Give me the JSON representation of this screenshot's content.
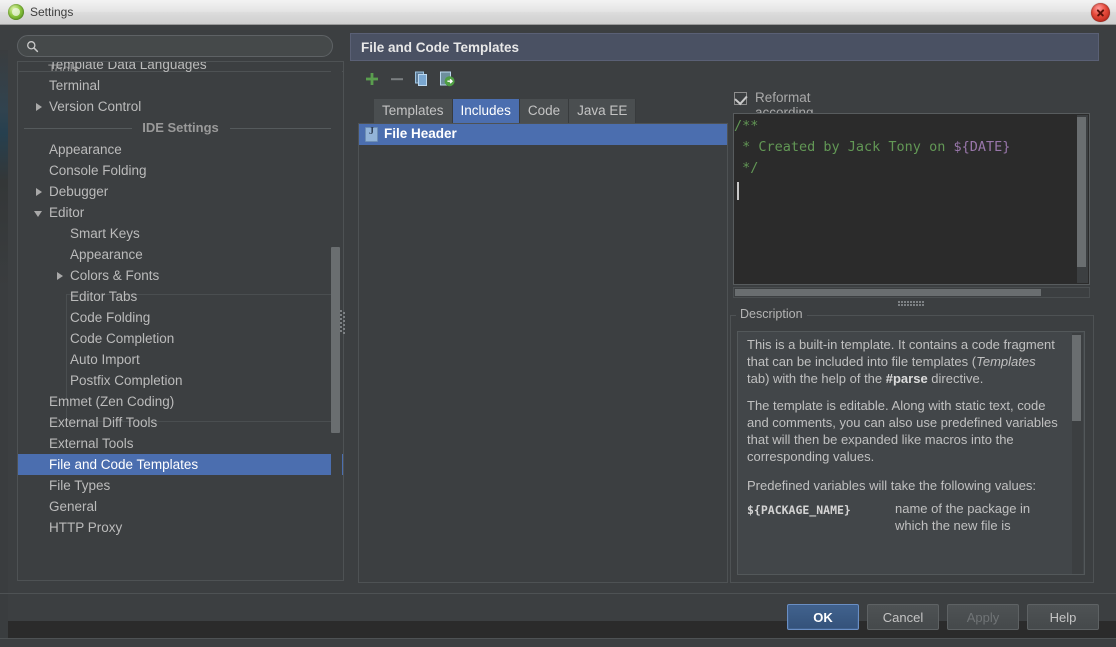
{
  "window": {
    "title": "Settings",
    "app_icon": "ide-logo-icon",
    "close_icon": "close-icon"
  },
  "sidebar": {
    "search": {
      "value": "",
      "placeholder": "",
      "icon": "search-icon"
    },
    "clipped_top_item": "Tools",
    "section_label": "IDE Settings",
    "items": [
      {
        "label": "Template Data Languages",
        "depth": 0,
        "arrow": "none",
        "selected": false
      },
      {
        "label": "Terminal",
        "depth": 0,
        "arrow": "none",
        "selected": false
      },
      {
        "label": "Version Control",
        "depth": 0,
        "arrow": "collapsed",
        "selected": false
      },
      {
        "label": "Appearance",
        "depth": 0,
        "arrow": "none",
        "selected": false
      },
      {
        "label": "Console Folding",
        "depth": 0,
        "arrow": "none",
        "selected": false
      },
      {
        "label": "Debugger",
        "depth": 0,
        "arrow": "collapsed",
        "selected": false
      },
      {
        "label": "Editor",
        "depth": 0,
        "arrow": "expanded",
        "selected": false
      },
      {
        "label": "Smart Keys",
        "depth": 1,
        "arrow": "none",
        "selected": false
      },
      {
        "label": "Appearance",
        "depth": 1,
        "arrow": "none",
        "selected": false
      },
      {
        "label": "Colors & Fonts",
        "depth": 1,
        "arrow": "collapsed",
        "selected": false
      },
      {
        "label": "Editor Tabs",
        "depth": 1,
        "arrow": "none",
        "selected": false
      },
      {
        "label": "Code Folding",
        "depth": 1,
        "arrow": "none",
        "selected": false
      },
      {
        "label": "Code Completion",
        "depth": 1,
        "arrow": "none",
        "selected": false
      },
      {
        "label": "Auto Import",
        "depth": 1,
        "arrow": "none",
        "selected": false
      },
      {
        "label": "Postfix Completion",
        "depth": 1,
        "arrow": "none",
        "selected": false
      },
      {
        "label": "Emmet (Zen Coding)",
        "depth": 0,
        "arrow": "none",
        "selected": false
      },
      {
        "label": "External Diff Tools",
        "depth": 0,
        "arrow": "none",
        "selected": false
      },
      {
        "label": "External Tools",
        "depth": 0,
        "arrow": "none",
        "selected": false
      },
      {
        "label": "File and Code Templates",
        "depth": 0,
        "arrow": "none",
        "selected": true
      },
      {
        "label": "File Types",
        "depth": 0,
        "arrow": "none",
        "selected": false
      },
      {
        "label": "General",
        "depth": 0,
        "arrow": "none",
        "selected": false
      },
      {
        "label": "HTTP Proxy",
        "depth": 0,
        "arrow": "none",
        "selected": false
      }
    ]
  },
  "panel": {
    "title": "File and Code Templates",
    "toolbar": [
      {
        "name": "add-template-button",
        "icon": "plus-icon",
        "color": "#5a9e4e"
      },
      {
        "name": "remove-template-button",
        "icon": "minus-icon",
        "color": "#7b7f81"
      },
      {
        "name": "copy-template-button",
        "icon": "copy-icon",
        "color": "#7aa7d0"
      },
      {
        "name": "clone-template-button",
        "icon": "export-icon",
        "color": "#5a9e4e"
      }
    ],
    "tabs": [
      {
        "label": "Templates",
        "active": false
      },
      {
        "label": "Includes",
        "active": true
      },
      {
        "label": "Code",
        "active": false
      },
      {
        "label": "Java EE",
        "active": false
      }
    ],
    "list": [
      {
        "label": "File Header",
        "icon": "java-file-icon",
        "selected": true
      }
    ]
  },
  "editor": {
    "reformat": {
      "label": "Reformat according to style",
      "checked": true
    },
    "code_lines": [
      {
        "segments": [
          {
            "text": "/**",
            "style": "comment"
          }
        ]
      },
      {
        "segments": [
          {
            "text": " * Created by Jack Tony on ",
            "style": "comment"
          },
          {
            "text": "${DATE}",
            "style": "macro"
          }
        ]
      },
      {
        "segments": [
          {
            "text": " */",
            "style": "comment"
          }
        ]
      }
    ]
  },
  "description": {
    "legend": "Description",
    "paragraphs": [
      "This is a built-in template. It contains a code fragment that can be included into file templates (Templates tab) with the help of the #parse directive.",
      "The template is editable. Along with static text, code and comments, you can also use predefined variables that will then be expanded like macros into the corresponding values.",
      "Predefined variables will take the following values:"
    ],
    "inline_italic": "Templates",
    "inline_bold": "#parse",
    "variables": [
      {
        "name": "${PACKAGE_NAME}",
        "meaning": "name of the package in which the new file is"
      }
    ]
  },
  "buttons": {
    "ok": "OK",
    "cancel": "Cancel",
    "apply": "Apply",
    "help": "Help"
  },
  "colors": {
    "accent_blue": "#4b6eaf",
    "panel_header": "#4a5163",
    "background": "#3c3f41",
    "editor_background": "#2b2b2b",
    "comment_green": "#629755",
    "macro_purple": "#9876aa"
  }
}
